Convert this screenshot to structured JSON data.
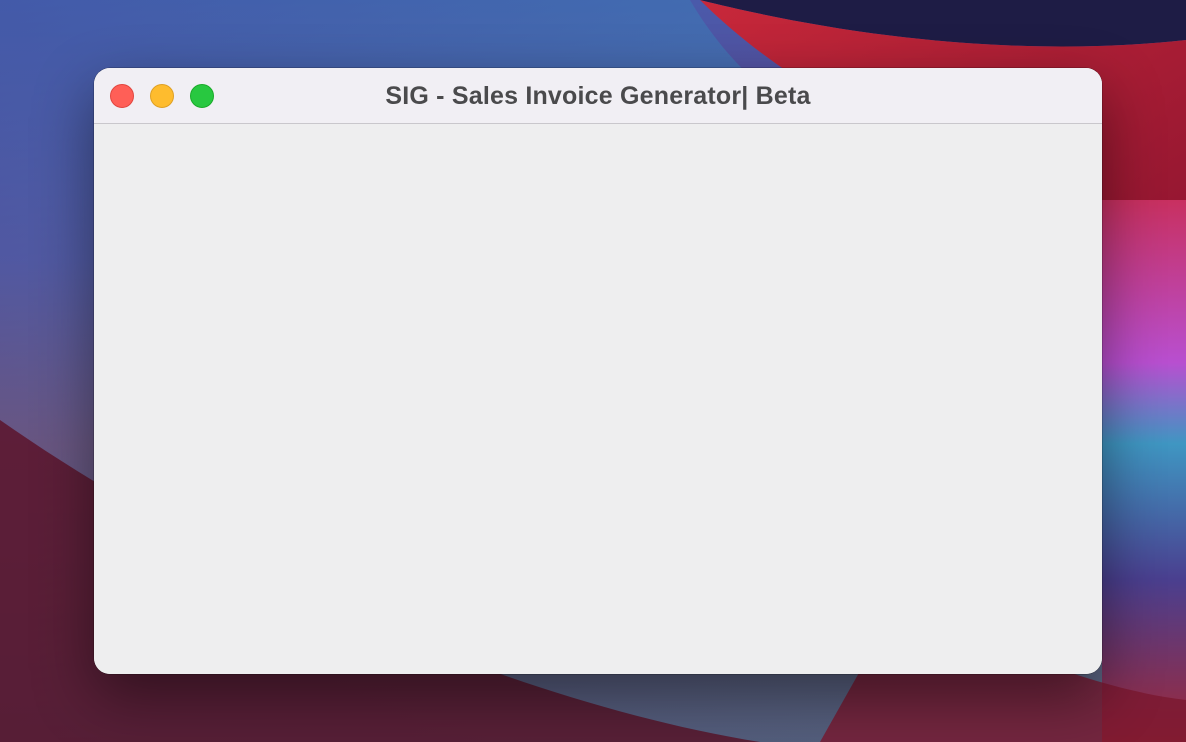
{
  "window": {
    "title": "SIG - Sales Invoice Generator| Beta",
    "controls": {
      "close": "close-icon",
      "minimize": "minimize-icon",
      "zoom": "zoom-icon"
    }
  },
  "colors": {
    "close": "#ff5f57",
    "minimize": "#febc2e",
    "zoom": "#28c840",
    "titlebar": "#f1eff4",
    "content": "#eeeeef"
  }
}
